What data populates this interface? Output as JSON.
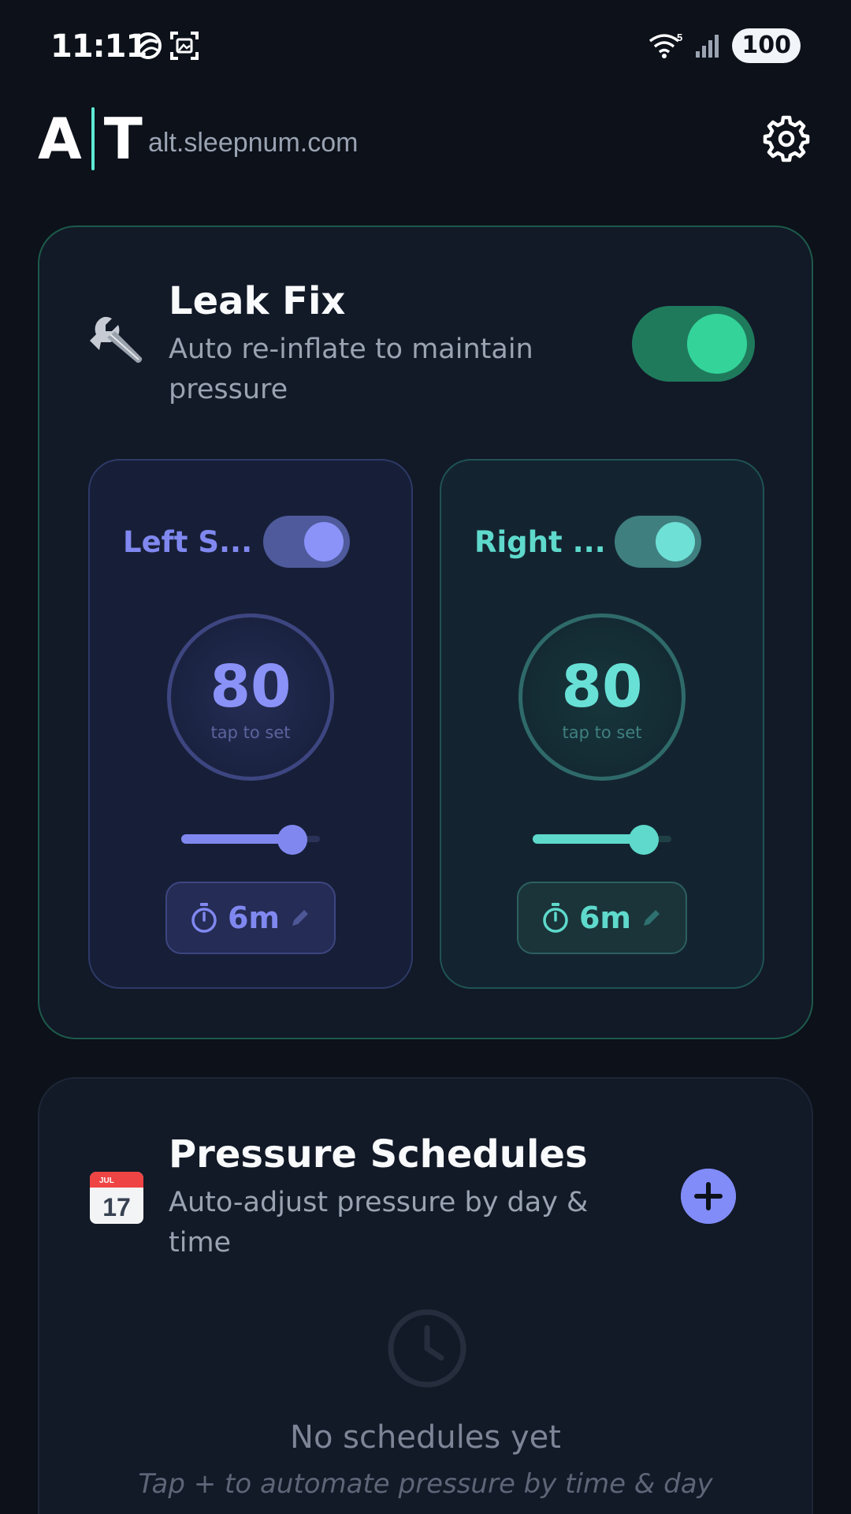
{
  "status_bar": {
    "time": "11:11",
    "network_badge": "5",
    "battery": "100"
  },
  "header": {
    "logo_left": "A",
    "logo_right": "T",
    "domain": "alt.sleepnum.com",
    "settings_icon": "gear-icon"
  },
  "leak_fix": {
    "icon": "wrench-icon",
    "title": "Leak Fix",
    "subtitle": "Auto re-inflate to maintain pressure",
    "enabled": true,
    "accent": "#34d399",
    "left": {
      "label": "Left S...",
      "enabled": true,
      "value": "80",
      "hint": "tap to set",
      "slider_fraction": 0.8,
      "timer": "6m",
      "accent": "#8088f0"
    },
    "right": {
      "label": "Right ...",
      "enabled": true,
      "value": "80",
      "hint": "tap to set",
      "slider_fraction": 0.8,
      "timer": "6m",
      "accent": "#5ed9cc"
    }
  },
  "schedules": {
    "icon": "calendar-icon",
    "calendar_month": "JUL",
    "calendar_day": "17",
    "title": "Pressure Schedules",
    "subtitle": "Auto-adjust pressure by day & time",
    "add_icon": "plus-icon",
    "empty_title": "No schedules yet",
    "empty_hint": "Tap + to automate pressure by time & day"
  }
}
